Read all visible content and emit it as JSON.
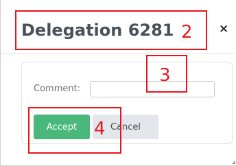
{
  "dialog": {
    "title": "Delegation 6281",
    "close_icon": "close-icon",
    "close_glyph": "×"
  },
  "form": {
    "comment_label": "Comment:",
    "comment_value": "",
    "comment_placeholder": ""
  },
  "buttons": {
    "accept_label": "Accept",
    "cancel_label": "Cancel"
  },
  "annotations": [
    {
      "number": "2"
    },
    {
      "number": "3"
    },
    {
      "number": "4"
    }
  ],
  "colors": {
    "accept": "#4ab87a",
    "cancel": "#e3e6ea",
    "annotation": "#e8141b",
    "title": "#4a5058"
  }
}
